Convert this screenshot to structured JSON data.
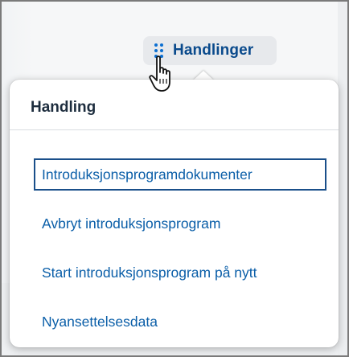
{
  "toolbar": {
    "actions_label": "Handlinger"
  },
  "popover": {
    "title": "Handling",
    "items": [
      {
        "label": "Introduksjonsprogramdokumenter",
        "focused": true
      },
      {
        "label": "Avbryt introduksjonsprogram",
        "focused": false
      },
      {
        "label": "Start introduksjonsprogram på nytt",
        "focused": false
      },
      {
        "label": "Nyansettelsesdata",
        "focused": false
      }
    ]
  },
  "icons": {
    "actions": "vertical-dots-icon",
    "cursor": "hand-pointer-icon"
  },
  "colors": {
    "link": "#0a5ea8",
    "accent": "#0a6ed1",
    "title": "#1d2d3e",
    "focus_border": "#1a4f8a"
  }
}
